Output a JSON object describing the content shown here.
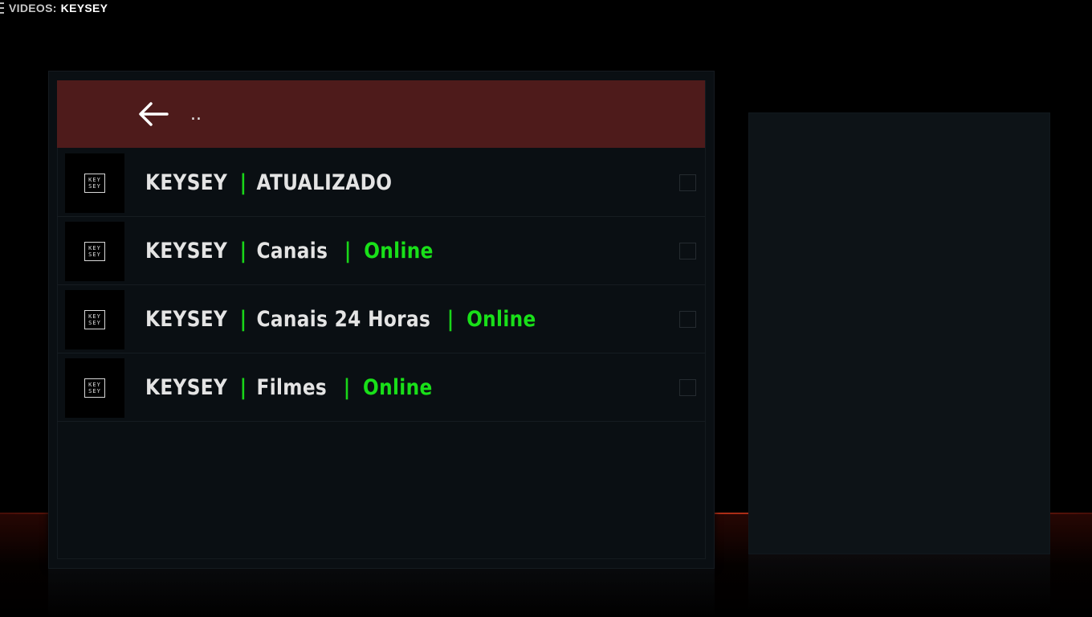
{
  "header": {
    "section": "VIDEOS:",
    "current": "KEYSEY"
  },
  "list": {
    "parent_item": {
      "label": "..",
      "icon": "back-arrow-icon"
    },
    "items": [
      {
        "logo_line1": "KEY",
        "logo_line2": "SEY",
        "name": "KEYSEY",
        "separator1": "|",
        "category": "ATUALIZADO",
        "separator2": "",
        "status": ""
      },
      {
        "logo_line1": "KEY",
        "logo_line2": "SEY",
        "name": "KEYSEY",
        "separator1": "|",
        "category": "Canais",
        "separator2": "|",
        "status": "Online"
      },
      {
        "logo_line1": "KEY",
        "logo_line2": "SEY",
        "name": "KEYSEY",
        "separator1": "|",
        "category": "Canais 24 Horas",
        "separator2": "|",
        "status": "Online"
      },
      {
        "logo_line1": "KEY",
        "logo_line2": "SEY",
        "name": "KEYSEY",
        "separator1": "|",
        "category": "Filmes",
        "separator2": "|",
        "status": "Online"
      }
    ]
  },
  "colors": {
    "selected_row": "#4e1b1b",
    "status_green": "#19e019",
    "horizon_red": "#e63c1e"
  }
}
